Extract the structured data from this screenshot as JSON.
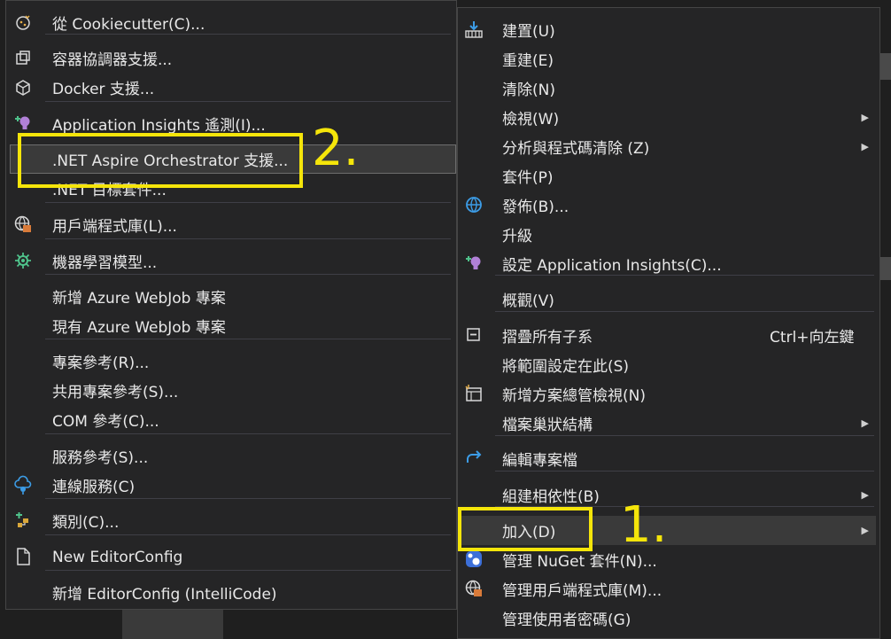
{
  "left_menu": {
    "items": [
      {
        "id": "cookiecutter",
        "label": "從 Cookiecutter(C)...",
        "icon": "cookiecutter-icon"
      },
      {
        "id": "container",
        "label": "容器協調器支援...",
        "icon": "container-icon"
      },
      {
        "id": "docker",
        "label": "Docker 支援...",
        "icon": "docker-icon"
      },
      {
        "id": "appinsights",
        "label": "Application Insights 遙測(I)...",
        "icon": "lightbulb-add-icon"
      },
      {
        "id": "aspire",
        "label": ".NET Aspire Orchestrator 支援...",
        "icon": ""
      },
      {
        "id": "targetframework",
        "label": ".NET 目標套件...",
        "icon": ""
      },
      {
        "id": "clientlib",
        "label": "用戶端程式庫(L)...",
        "icon": "client-library-icon"
      },
      {
        "id": "mlmodel",
        "label": "機器學習模型...",
        "icon": "ml-model-icon"
      },
      {
        "id": "newwebjob",
        "label": "新增 Azure WebJob 專案",
        "icon": ""
      },
      {
        "id": "existingwebjob",
        "label": "現有 Azure WebJob 專案",
        "icon": ""
      },
      {
        "id": "projref",
        "label": "專案參考(R)...",
        "icon": ""
      },
      {
        "id": "sharedref",
        "label": "共用專案參考(S)...",
        "icon": ""
      },
      {
        "id": "comref",
        "label": "COM 參考(C)...",
        "icon": ""
      },
      {
        "id": "serviceref",
        "label": "服務參考(S)...",
        "icon": ""
      },
      {
        "id": "connectedservice",
        "label": "連線服務(C)",
        "icon": "connected-service-icon"
      },
      {
        "id": "class",
        "label": "類別(C)...",
        "icon": "class-icon"
      },
      {
        "id": "editorconfig",
        "label": "New EditorConfig",
        "icon": "document-icon"
      },
      {
        "id": "editorconfig-ic",
        "label": "新增 EditorConfig (IntelliCode)",
        "icon": ""
      }
    ]
  },
  "right_menu": {
    "items": [
      {
        "id": "build",
        "label": "建置(U)",
        "icon": "build-icon",
        "submenu": false,
        "shortcut": ""
      },
      {
        "id": "rebuild",
        "label": "重建(E)",
        "icon": "",
        "submenu": false,
        "shortcut": ""
      },
      {
        "id": "clean",
        "label": "清除(N)",
        "icon": "",
        "submenu": false,
        "shortcut": ""
      },
      {
        "id": "view",
        "label": "檢視(W)",
        "icon": "",
        "submenu": true,
        "shortcut": ""
      },
      {
        "id": "analyze",
        "label": "分析與程式碼清除 (Z)",
        "icon": "",
        "submenu": true,
        "shortcut": ""
      },
      {
        "id": "pack",
        "label": "套件(P)",
        "icon": "",
        "submenu": false,
        "shortcut": ""
      },
      {
        "id": "publish",
        "label": "發佈(B)...",
        "icon": "globe-icon",
        "submenu": false,
        "shortcut": ""
      },
      {
        "id": "upgrade",
        "label": "升級",
        "icon": "",
        "submenu": false,
        "shortcut": ""
      },
      {
        "id": "configinsights",
        "label": "設定 Application Insights(C)...",
        "icon": "lightbulb-add-icon",
        "submenu": false,
        "shortcut": ""
      },
      {
        "id": "overview",
        "label": "概觀(V)",
        "icon": "",
        "submenu": false,
        "shortcut": ""
      },
      {
        "id": "collapse",
        "label": "摺疊所有子系",
        "icon": "collapse-icon",
        "submenu": false,
        "shortcut": "Ctrl+向左鍵"
      },
      {
        "id": "scope",
        "label": "將範圍設定在此(S)",
        "icon": "",
        "submenu": false,
        "shortcut": ""
      },
      {
        "id": "newview",
        "label": "新增方案總管檢視(N)",
        "icon": "new-view-icon",
        "submenu": false,
        "shortcut": ""
      },
      {
        "id": "nesting",
        "label": "檔案巢狀結構",
        "icon": "",
        "submenu": true,
        "shortcut": ""
      },
      {
        "id": "editproj",
        "label": "編輯專案檔",
        "icon": "redo-arrow-icon",
        "submenu": false,
        "shortcut": ""
      },
      {
        "id": "builddeps",
        "label": "組建相依性(B)",
        "icon": "",
        "submenu": true,
        "shortcut": ""
      },
      {
        "id": "add",
        "label": "加入(D)",
        "icon": "",
        "submenu": true,
        "shortcut": ""
      },
      {
        "id": "nuget",
        "label": "管理 NuGet 套件(N)...",
        "icon": "nuget-icon",
        "submenu": false,
        "shortcut": ""
      },
      {
        "id": "clientlibs",
        "label": "管理用戶端程式庫(M)...",
        "icon": "client-library-icon",
        "submenu": false,
        "shortcut": ""
      },
      {
        "id": "secrets",
        "label": "管理使用者密碼(G)",
        "icon": "",
        "submenu": false,
        "shortcut": ""
      }
    ]
  },
  "annotations": {
    "step1": "1.",
    "step2": "2.",
    "color": "#f5e50a"
  },
  "colors": {
    "menu_bg": "#252526",
    "text": "#e8e8e8",
    "highlight": "#3a3a3a",
    "icon_blue": "#3c9ce6",
    "icon_purple": "#b180d7",
    "icon_green": "#4fc28b"
  }
}
